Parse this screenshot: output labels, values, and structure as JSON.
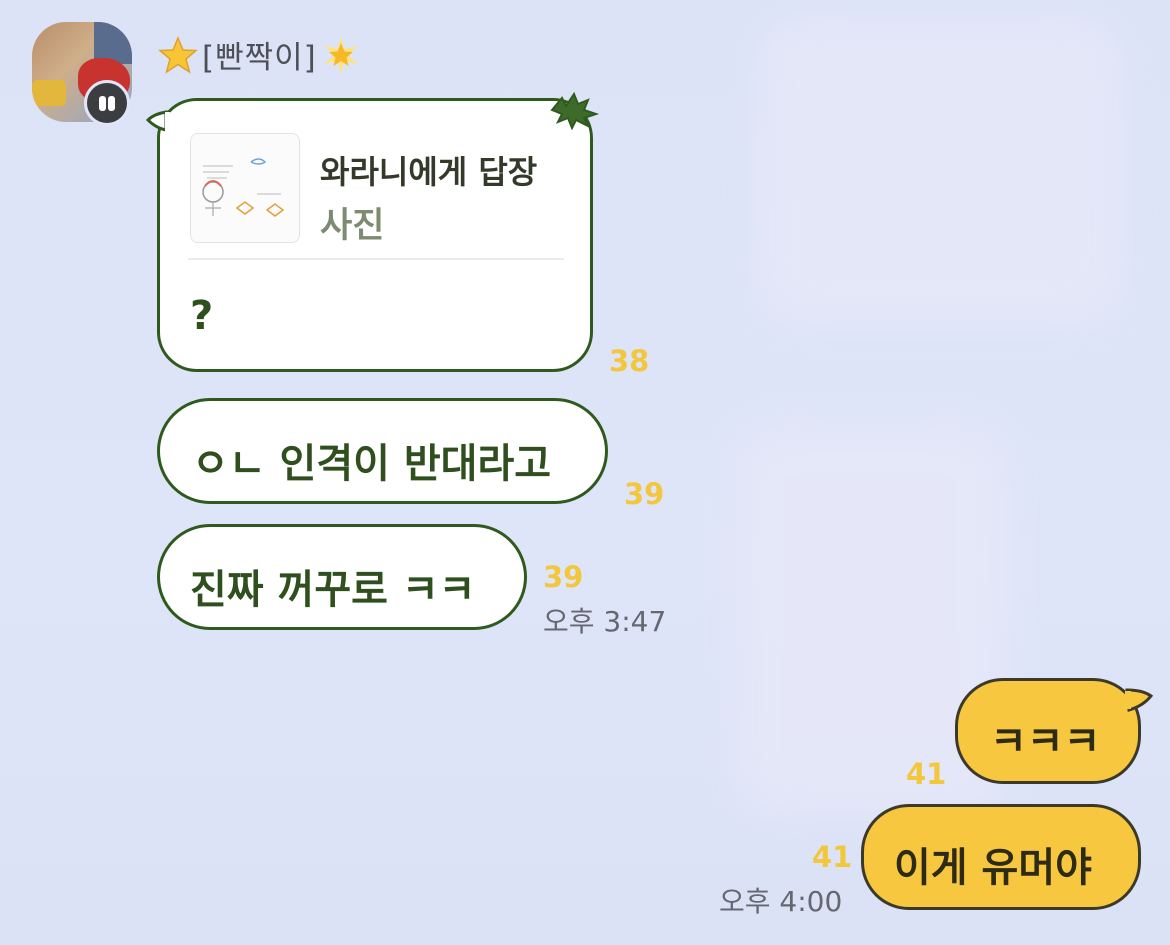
{
  "sender": {
    "name": "[빤짝이]"
  },
  "messages_in": [
    {
      "reply": {
        "title": "와라니에게 답장",
        "subtitle": "사진"
      },
      "text": "?",
      "unread": "38"
    },
    {
      "text": "ㅇㄴ 인격이 반대라고",
      "unread": "39"
    },
    {
      "text": "진짜 꺼꾸로 ㅋㅋ",
      "unread": "39",
      "time": "오후 3:47"
    }
  ],
  "messages_out": [
    {
      "text": "ㅋㅋㅋ",
      "unread": "41"
    },
    {
      "text": "이게 유머야",
      "unread": "41",
      "time": "오후 4:00"
    }
  ],
  "colors": {
    "background": "#dde3f7",
    "incoming_bubble": "#ffffff",
    "incoming_border": "#2f5a1e",
    "outgoing_bubble": "#f7c83f",
    "unread_count": "#f3c73d"
  }
}
